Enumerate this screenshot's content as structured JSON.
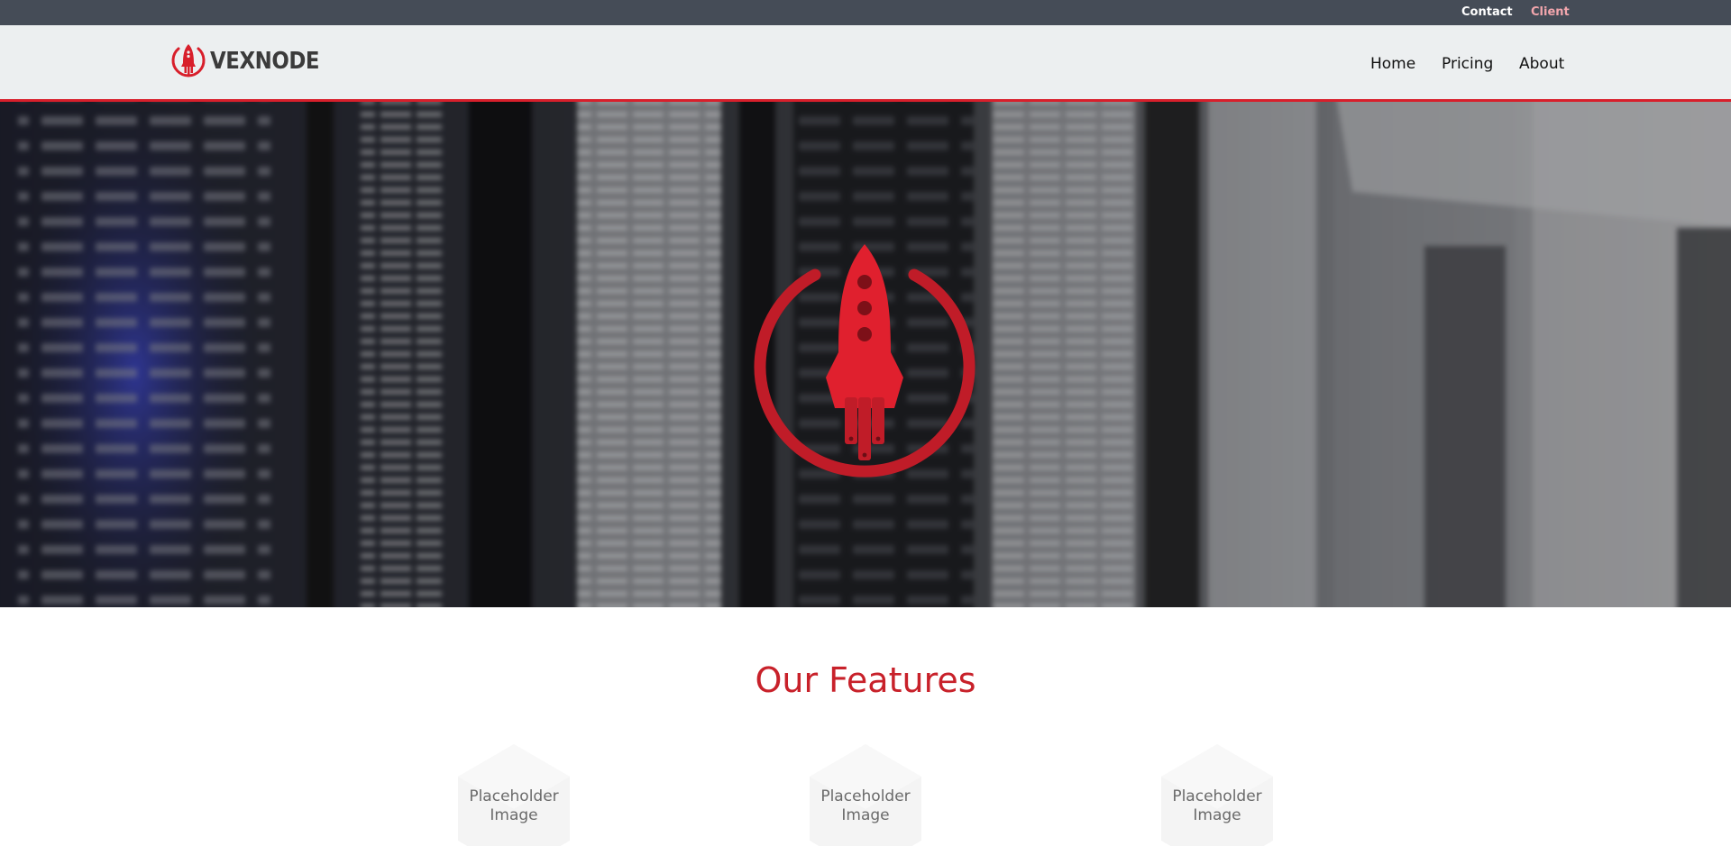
{
  "topbar": {
    "contact_label": "Contact",
    "client_label": "Client"
  },
  "header": {
    "brand": "VEXNODE",
    "nav": [
      {
        "label": "Home"
      },
      {
        "label": "Pricing"
      },
      {
        "label": "About"
      }
    ]
  },
  "hero": {
    "icon": "rocket-power-icon",
    "background": "server-rack-photo"
  },
  "features": {
    "title": "Our Features",
    "items": [
      {
        "image_text": "Placeholder Image"
      },
      {
        "image_text": "Placeholder Image"
      },
      {
        "image_text": "Placeholder Image"
      }
    ]
  },
  "colors": {
    "accent": "#d81f2b",
    "topbar": "#454c57",
    "header": "#eceff0",
    "title": "#c8212a"
  }
}
